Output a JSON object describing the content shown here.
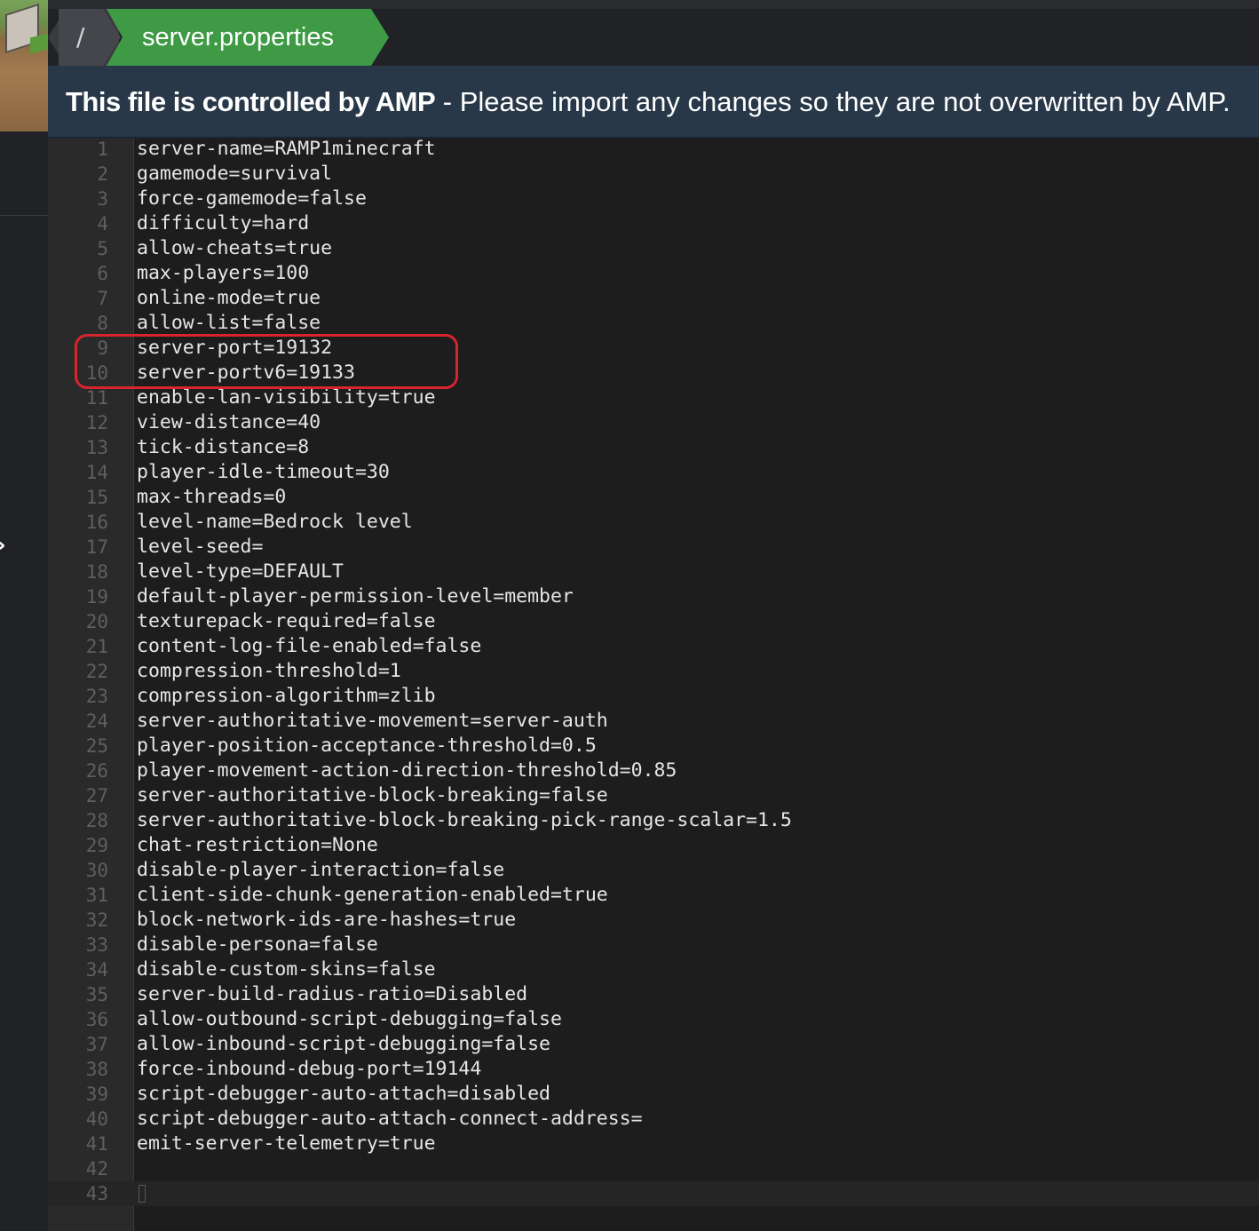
{
  "breadcrumb": {
    "root": "/",
    "file": "server.properties"
  },
  "banner": {
    "strong": "This file is controlled by AMP",
    "rest": " - Please import any changes so they are not overwritten by AMP."
  },
  "editor": {
    "lines": [
      "server-name=RAMP1minecraft",
      "gamemode=survival",
      "force-gamemode=false",
      "difficulty=hard",
      "allow-cheats=true",
      "max-players=100",
      "online-mode=true",
      "allow-list=false",
      "server-port=19132",
      "server-portv6=19133",
      "enable-lan-visibility=true",
      "view-distance=40",
      "tick-distance=8",
      "player-idle-timeout=30",
      "max-threads=0",
      "level-name=Bedrock level",
      "level-seed=",
      "level-type=DEFAULT",
      "default-player-permission-level=member",
      "texturepack-required=false",
      "content-log-file-enabled=false",
      "compression-threshold=1",
      "compression-algorithm=zlib",
      "server-authoritative-movement=server-auth",
      "player-position-acceptance-threshold=0.5",
      "player-movement-action-direction-threshold=0.85",
      "server-authoritative-block-breaking=false",
      "server-authoritative-block-breaking-pick-range-scalar=1.5",
      "chat-restriction=None",
      "disable-player-interaction=false",
      "client-side-chunk-generation-enabled=true",
      "block-network-ids-are-hashes=true",
      "disable-persona=false",
      "disable-custom-skins=false",
      "server-build-radius-ratio=Disabled",
      "allow-outbound-script-debugging=false",
      "allow-inbound-script-debugging=false",
      "force-inbound-debug-port=19144",
      "script-debugger-auto-attach=disabled",
      "script-debugger-auto-attach-connect-address=",
      "emit-server-telemetry=true",
      "",
      ""
    ]
  },
  "colors": {
    "crumb_active": "#3f9a45",
    "banner_bg": "#283848",
    "annotation": "#d8242e"
  },
  "icons": {
    "left_toggle": "chevron-right-icon"
  }
}
